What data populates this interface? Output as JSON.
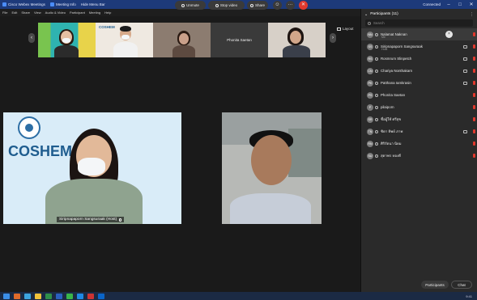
{
  "window": {
    "title": "Cisco Webex Meetings",
    "tab_meeting": "Meeting Info",
    "tab_hide": "Hide Menu Bar",
    "status": "Connected",
    "min": "–",
    "max": "□",
    "close": "✕"
  },
  "menu": [
    "File",
    "Edit",
    "Share",
    "View",
    "Audio & Video",
    "Participant",
    "Meeting",
    "Help"
  ],
  "layout_label": "Layout",
  "gallery": {
    "tile4_name": "Phonita Saetan"
  },
  "main_video": {
    "left_name": "Siripnapaporn Sangsuraak (Host)",
    "left_logo": "COSHEM"
  },
  "toolbar": {
    "unmute": "Unmute",
    "stop_video": "Stop video",
    "share": "Share",
    "more": "···",
    "end": "✕"
  },
  "participants": {
    "header": "Participants (11)",
    "search_placeholder": "Search",
    "items": [
      {
        "initials": "NN",
        "name": "Nalamat Naknan",
        "sub": "Me"
      },
      {
        "initials": "SS",
        "name": "Siripnapaporn Sangsuraak",
        "sub": "Host"
      },
      {
        "initials": "RS",
        "name": "Rosmrum Slinpetch",
        "sub": ""
      },
      {
        "initials": "CN",
        "name": "Chariya Nonthakarn",
        "sub": ""
      },
      {
        "initials": "PK",
        "name": "Patthana Iamkrasin",
        "sub": ""
      },
      {
        "initials": "PS",
        "name": "Phonita Saetan",
        "sub": ""
      },
      {
        "initials": "P",
        "name": "pilaiporn",
        "sub": ""
      },
      {
        "initials": "SR",
        "name": "ชื่อผู้ใช้ ศรีสุข",
        "sub": ""
      },
      {
        "initials": "TN",
        "name": "ชิดา ทิพย์ ภาพ",
        "sub": ""
      },
      {
        "initials": "RN",
        "name": "ศิริรัตนา นิยม",
        "sub": ""
      },
      {
        "initials": "SU",
        "name": "สุดาพร ทองดี",
        "sub": ""
      }
    ],
    "footer_participants": "Participants",
    "footer_chat": "Chat"
  },
  "taskbar": {
    "clock": "9:41"
  }
}
